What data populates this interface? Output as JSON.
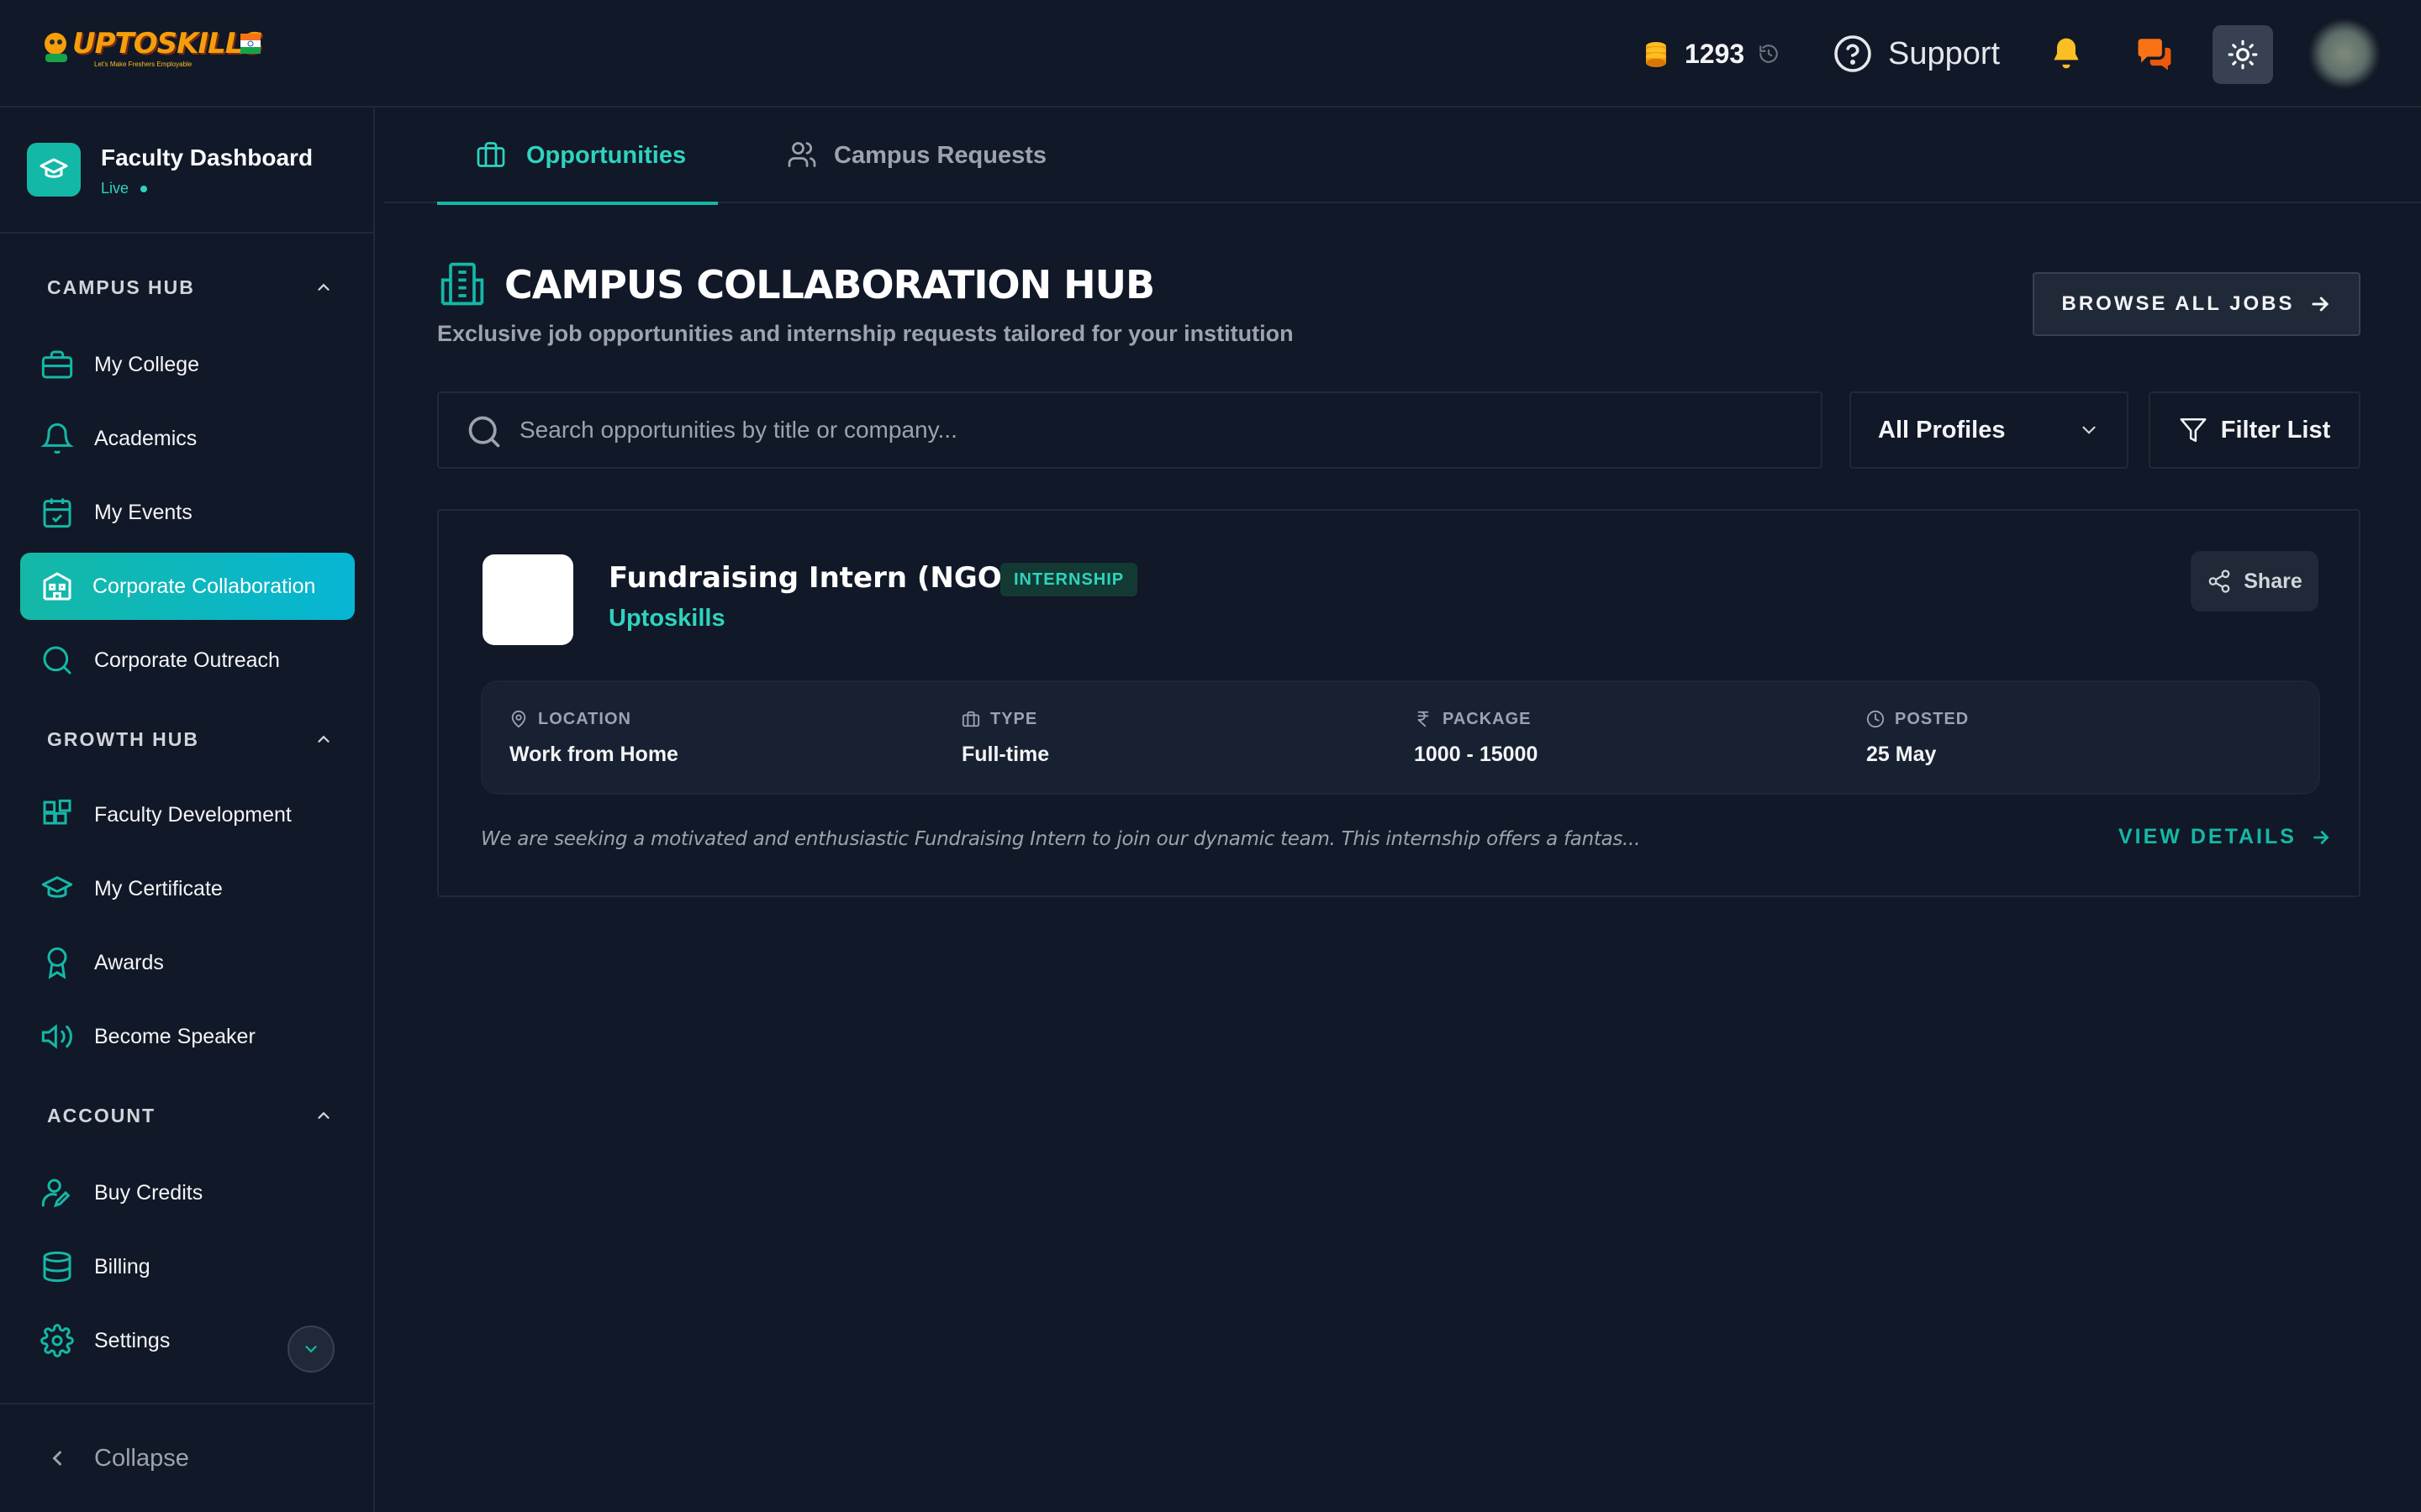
{
  "header": {
    "logo_text": "UPTOSKILLS",
    "logo_tagline": "Let's Make Freshers Employable",
    "coins": "1293",
    "support_label": "Support",
    "icons": [
      "coins-icon",
      "history-icon",
      "help-circle-icon",
      "bell-icon",
      "chat-icon",
      "sun-icon"
    ],
    "accent_colors": {
      "bell": "#fbbf24",
      "chat": "#f97316",
      "coins": "#fbbf24"
    }
  },
  "sidebar": {
    "dashboard_title": "Faculty Dashboard",
    "status": "Live",
    "sections": [
      {
        "label": "CAMPUS HUB",
        "items": [
          {
            "label": "My College",
            "icon": "briefcase-icon"
          },
          {
            "label": "Academics",
            "icon": "bell-icon"
          },
          {
            "label": "My Events",
            "icon": "calendar-check-icon"
          },
          {
            "label": "Corporate Collaboration",
            "icon": "building-icon",
            "active": true
          },
          {
            "label": "Corporate Outreach",
            "icon": "search-icon"
          }
        ]
      },
      {
        "label": "GROWTH HUB",
        "items": [
          {
            "label": "Faculty Development",
            "icon": "blocks-icon"
          },
          {
            "label": "My Certificate",
            "icon": "graduation-cap-icon"
          },
          {
            "label": "Awards",
            "icon": "award-icon"
          },
          {
            "label": "Become Speaker",
            "icon": "speaker-icon"
          }
        ]
      },
      {
        "label": "ACCOUNT",
        "items": [
          {
            "label": "Buy Credits",
            "icon": "user-edit-icon"
          },
          {
            "label": "Billing",
            "icon": "database-icon"
          },
          {
            "label": "Settings",
            "icon": "gear-icon"
          }
        ]
      }
    ],
    "collapse_label": "Collapse",
    "accent_color": "#14b8a6"
  },
  "tabs": [
    {
      "label": "Opportunities",
      "active": true
    },
    {
      "label": "Campus Requests",
      "active": false
    }
  ],
  "hub": {
    "title": "CAMPUS COLLABORATION HUB",
    "subtitle": "Exclusive job opportunities and internship requests tailored for your institution",
    "browse_label": "BROWSE ALL JOBS"
  },
  "filters": {
    "search_placeholder": "Search opportunities by title or company...",
    "search_value": "",
    "profile_selected": "All Profiles",
    "filter_label": "Filter List"
  },
  "jobs": [
    {
      "title": "Fundraising Intern (NGO)",
      "badge": "INTERNSHIP",
      "company": "Uptoskills",
      "share_label": "Share",
      "meta": [
        {
          "key": "LOCATION",
          "value": "Work from Home",
          "icon": "map-pin-icon"
        },
        {
          "key": "TYPE",
          "value": "Full-time",
          "icon": "briefcase-icon"
        },
        {
          "key": "PACKAGE",
          "value": "1000 - 15000",
          "icon": "rupee-icon"
        },
        {
          "key": "POSTED",
          "value": "25 May",
          "icon": "clock-icon"
        }
      ],
      "description": "We are seeking a motivated and enthusiastic Fundraising Intern to join our dynamic team. This internship offers a fantas...",
      "view_label": "VIEW DETAILS"
    }
  ]
}
